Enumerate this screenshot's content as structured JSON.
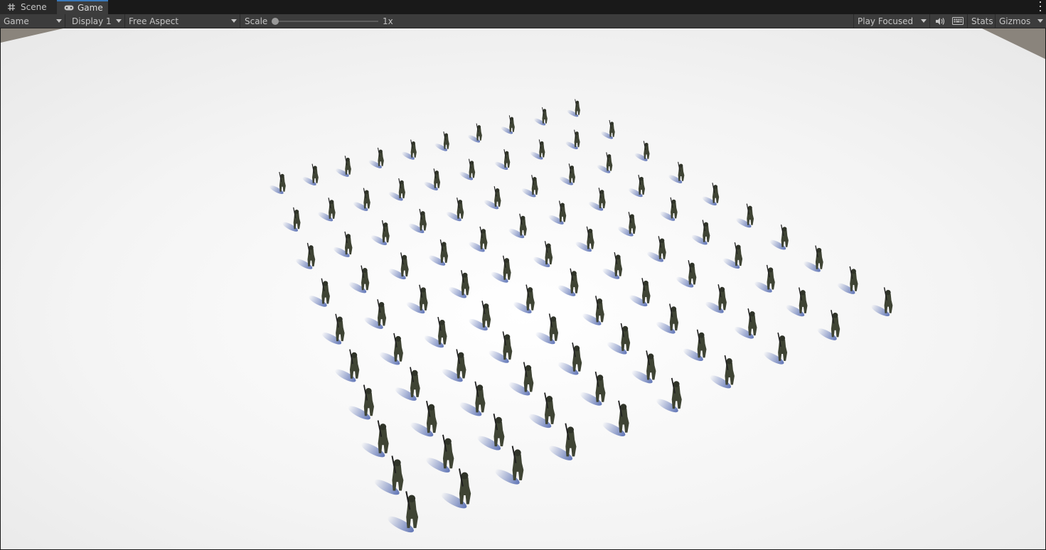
{
  "tabs": [
    {
      "label": "Scene",
      "icon": "grid-icon"
    },
    {
      "label": "Game",
      "icon": "gamepad-icon"
    }
  ],
  "toolbar": {
    "view_label": "Game",
    "display_label": "Display 1",
    "aspect_label": "Free Aspect",
    "scale_label": "Scale",
    "scale_value": "1x",
    "scale_fraction": 0.0,
    "play_mode_label": "Play Focused",
    "stats_label": "Stats",
    "gizmos_label": "Gizmos"
  },
  "colors": {
    "ground": "#f4f4f4",
    "background_grey": "#8a847c",
    "soldier": "#3f4434",
    "shadow": "#3a57a8",
    "accent_tab": "#3a79bb"
  },
  "scene": {
    "description_icon": "soldier-crowd"
  }
}
